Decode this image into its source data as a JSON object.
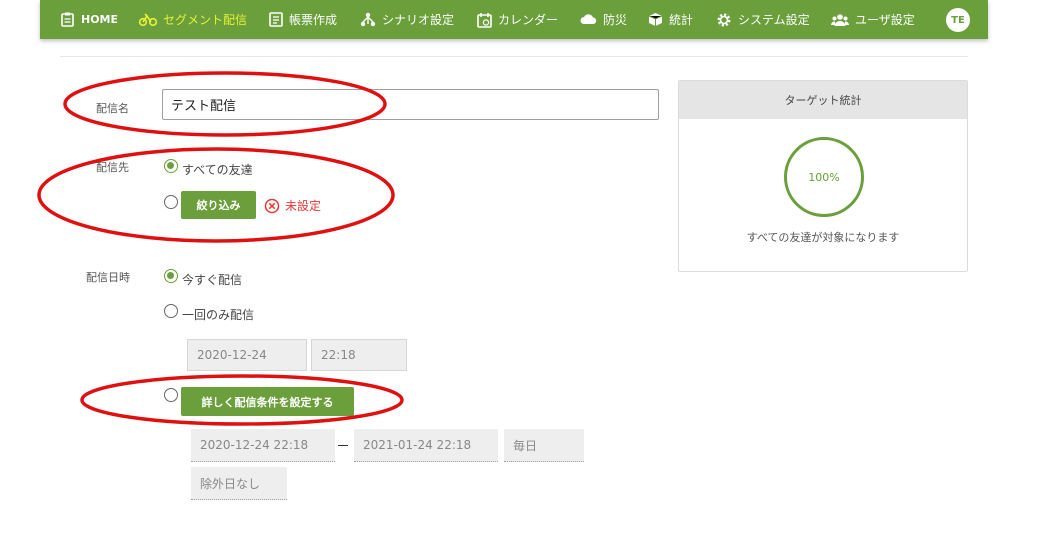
{
  "nav": {
    "items": [
      {
        "label": "HOME",
        "icon": "clipboard-icon"
      },
      {
        "label": "セグメント配信",
        "icon": "bicycle-icon"
      },
      {
        "label": "帳票作成",
        "icon": "document-icon"
      },
      {
        "label": "シナリオ設定",
        "icon": "sitemap-icon"
      },
      {
        "label": "カレンダー",
        "icon": "calendar-icon"
      },
      {
        "label": "防災",
        "icon": "cloud-icon"
      },
      {
        "label": "統計",
        "icon": "cube-icon"
      },
      {
        "label": "システム設定",
        "icon": "gear-icon"
      },
      {
        "label": "ユーザ設定",
        "icon": "users-icon"
      }
    ],
    "active_index": 1,
    "avatar": "TE"
  },
  "form": {
    "name_label": "配信名",
    "name_value": "テスト配信",
    "dest_label": "配信先",
    "dest_all": "すべての友達",
    "filter_button": "絞り込み",
    "filter_status": "未設定",
    "datetime_label": "配信日時",
    "now": "今すぐ配信",
    "once": "一回のみ配信",
    "once_date": "2020-12-24",
    "once_time": "22:18",
    "advanced_button": "詳しく配信条件を設定する",
    "adv_start": "2020-12-24 22:18",
    "adv_end": "2021-01-24 22:18",
    "adv_repeat": "毎日",
    "adv_exclude": "除外日なし"
  },
  "target": {
    "title": "ターゲット統計",
    "percent": "100%",
    "caption": "すべての友達が対象になります"
  },
  "colors": {
    "brand_green": "#6a9f3b",
    "active_nav": "#e8f03a",
    "annotation_red": "#e01010",
    "error_red": "#e53935"
  }
}
